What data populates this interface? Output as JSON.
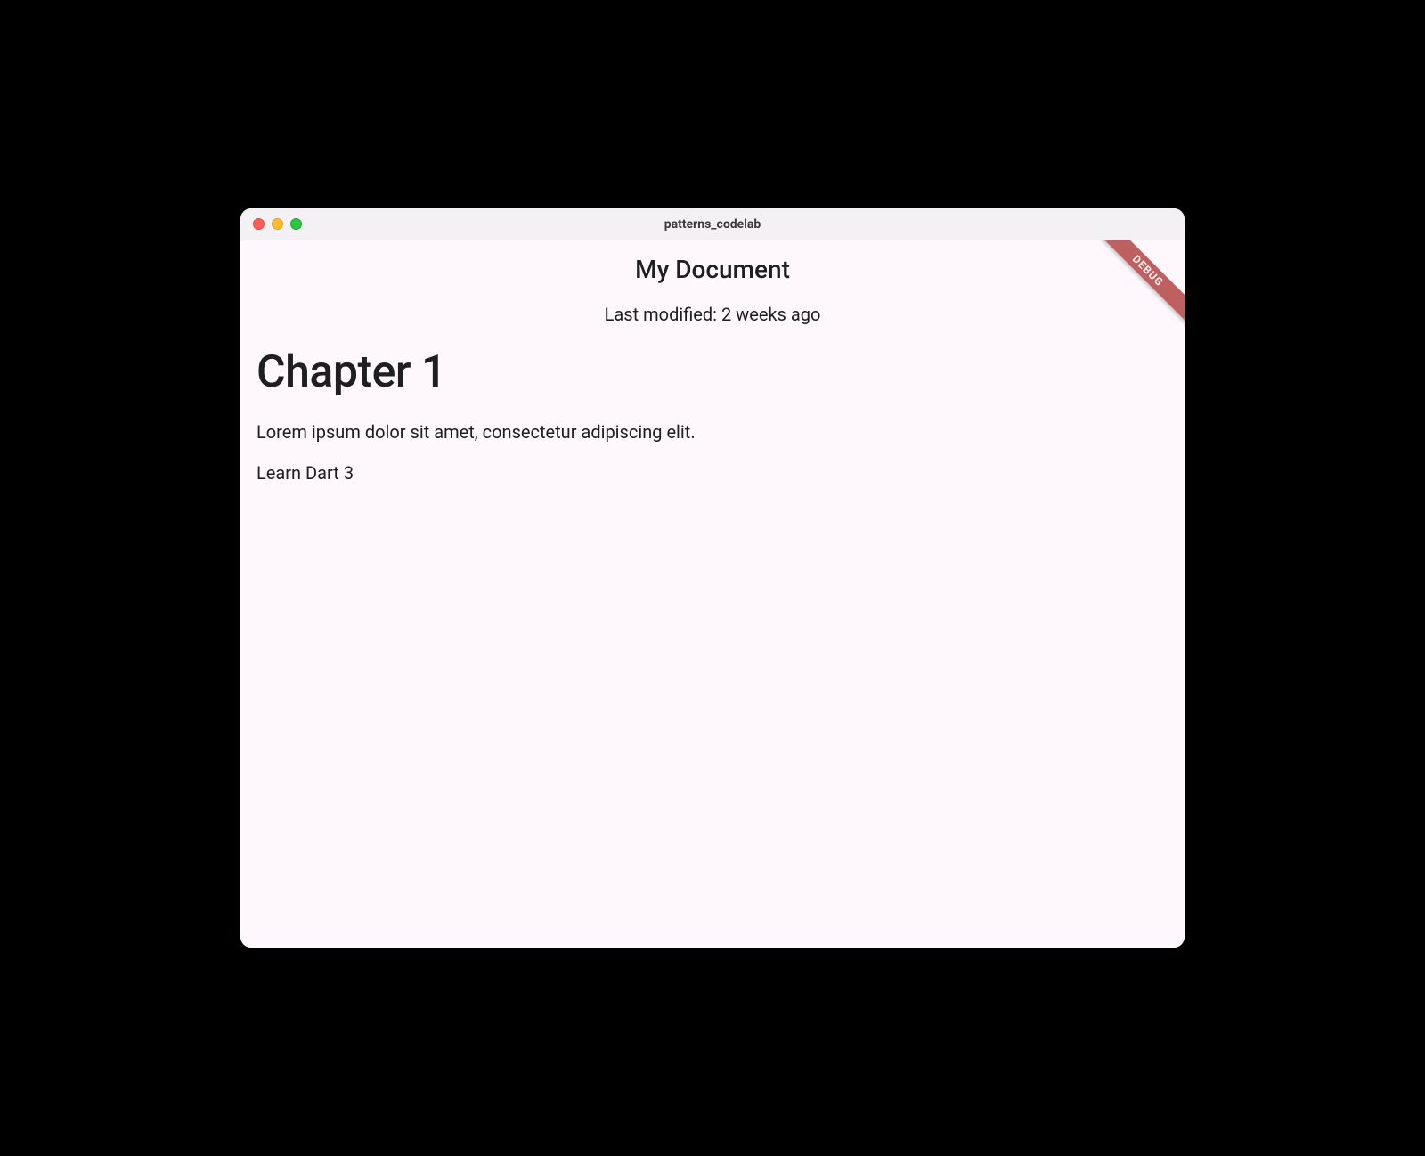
{
  "window": {
    "title": "patterns_codelab"
  },
  "debug_banner": {
    "label": "DEBUG"
  },
  "document": {
    "title": "My Document",
    "last_modified": "Last modified: 2 weeks ago",
    "blocks": [
      {
        "type": "h1",
        "text": "Chapter 1"
      },
      {
        "type": "p",
        "text": "Lorem ipsum dolor sit amet, consectetur adipiscing elit."
      },
      {
        "type": "p",
        "text": "Learn Dart 3"
      }
    ]
  }
}
